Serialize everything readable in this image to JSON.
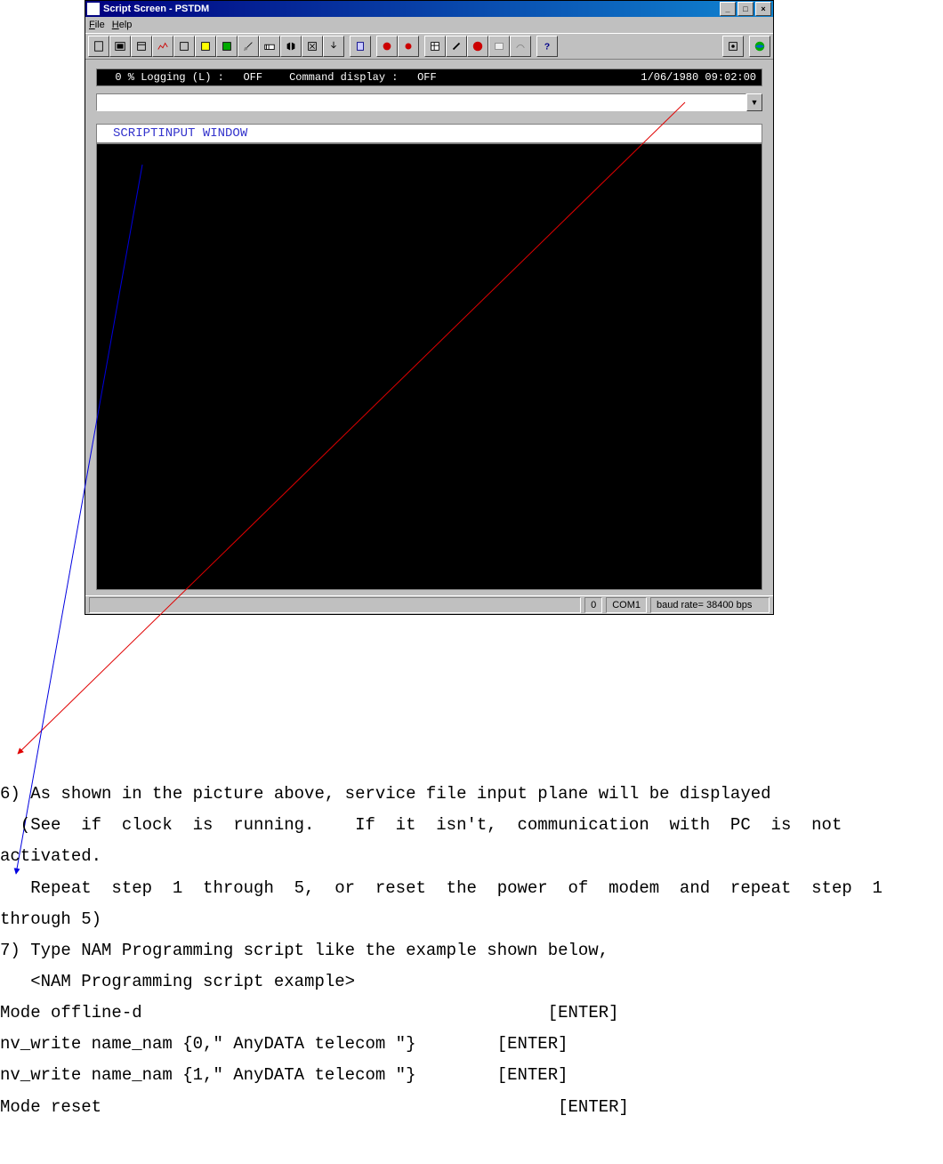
{
  "window": {
    "title": "Script Screen - PSTDM",
    "menu": {
      "file": "File",
      "help": "Help"
    },
    "controls": {
      "min": "_",
      "max": "□",
      "close": "×"
    }
  },
  "status_strip": {
    "percent": "0 %",
    "logging_label": "Logging (L) :",
    "logging_value": "OFF",
    "command_label": "Command display :",
    "command_value": "OFF",
    "datetime": "1/06/1980 09:02:00"
  },
  "script_input_label": "SCRIPTINPUT WINDOW",
  "statusbar": {
    "count": "0",
    "port": "COM1",
    "baud": "baud rate= 38400 bps"
  },
  "doc": {
    "p6a": "6) As shown in the picture above, service file input plane will be displayed",
    "p6b": "  (See  if  clock  is  running.    If  it  isn't,  communication  with  PC  is  not",
    "p6c": "activated.",
    "p6d": "   Repeat  step  1  through  5,  or  reset  the  power  of  modem  and  repeat  step  1",
    "p6e": "through 5)",
    "p7a": "7) Type NAM Programming script like the example shown below,",
    "p7b": "   <NAM Programming script example>",
    "s1": "Mode offline-d",
    "s2": "nv_write name_nam {0,\" AnyDATA telecom \"}",
    "s3": "nv_write name_nam {1,\" AnyDATA telecom \"}",
    "s4": "Mode reset",
    "enter": "[ENTER]"
  }
}
